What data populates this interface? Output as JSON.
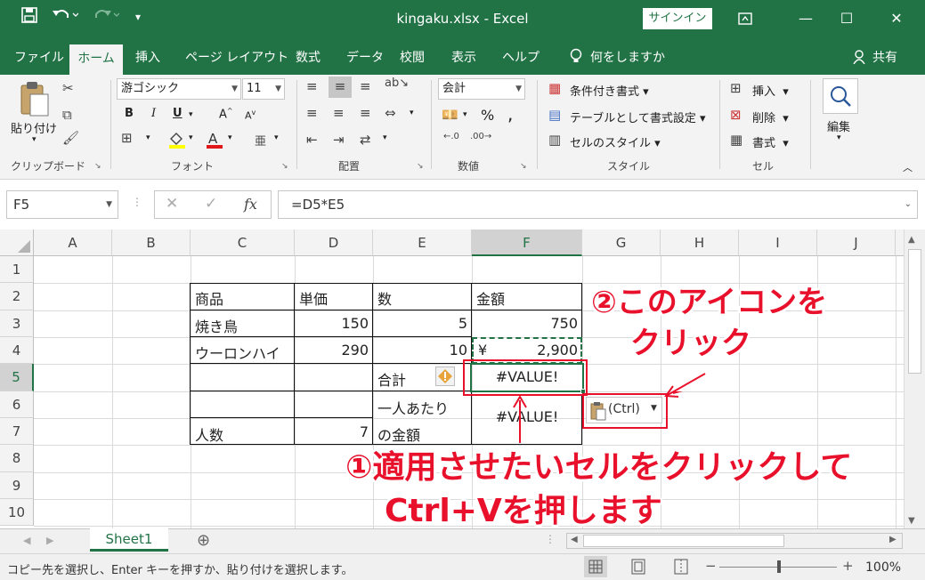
{
  "window": {
    "title": "kingaku.xlsx  -  Excel",
    "signin_label": "サインイン"
  },
  "tabs": [
    "ファイル",
    "ホーム",
    "挿入",
    "ページ レイアウト",
    "数式",
    "データ",
    "校閲",
    "表示",
    "ヘルプ"
  ],
  "tell_me": "何をしますか",
  "share_label": "共有",
  "ribbon": {
    "paste_label": "貼り付け",
    "clipboard_group": "クリップボード",
    "font_name": "游ゴシック",
    "font_size": "11",
    "font_group": "フォント",
    "bold": "B",
    "italic": "I",
    "underline": "U",
    "alignment_group": "配置",
    "number_format": "会計",
    "number_group": "数値",
    "percent": "%",
    "conditional_format": "条件付き書式",
    "format_as_table": "テーブルとして書式設定",
    "cell_styles": "セルのスタイル",
    "styles_group": "スタイル",
    "insert": "挿入",
    "delete": "削除",
    "format": "書式",
    "cells_group": "セル",
    "editing": "編集"
  },
  "formula_bar": {
    "name_box": "F5",
    "formula": "=D5*E5",
    "fx": "fx"
  },
  "columns": [
    "A",
    "B",
    "C",
    "D",
    "E",
    "F",
    "G",
    "H",
    "I",
    "J"
  ],
  "rows": [
    "1",
    "2",
    "3",
    "4",
    "5",
    "6",
    "7",
    "8",
    "9",
    "10"
  ],
  "cells": {
    "c2": "商品",
    "d2": "単価",
    "e2": "数",
    "f2": "金額",
    "c3": "焼き鳥",
    "d3": "150",
    "e3": "5",
    "f3": "750",
    "c4": "ウーロンハイ",
    "d4": "290",
    "e4": "10",
    "f4_currency": "¥",
    "f4": "2,900",
    "e5": "合計",
    "f5": "#VALUE!",
    "e6": "一人あたり",
    "f6": "#VALUE!",
    "c7": "人数",
    "d7": "7",
    "e7": "の金額"
  },
  "paste_options_label": "(Ctrl)",
  "annotations": {
    "step2": "②このアイコンを",
    "step2_line2": "クリック",
    "step1": "①適用させたいセルをクリックして",
    "step1_line2": "Ctrl+Vを押します"
  },
  "sheet_tab": "Sheet1",
  "status": {
    "message": "コピー先を選択し、Enter キーを押すか、貼り付けを選択します。",
    "zoom": "100%"
  },
  "colors": {
    "excel_green": "#217346",
    "annotation_red": "#e8102a"
  }
}
